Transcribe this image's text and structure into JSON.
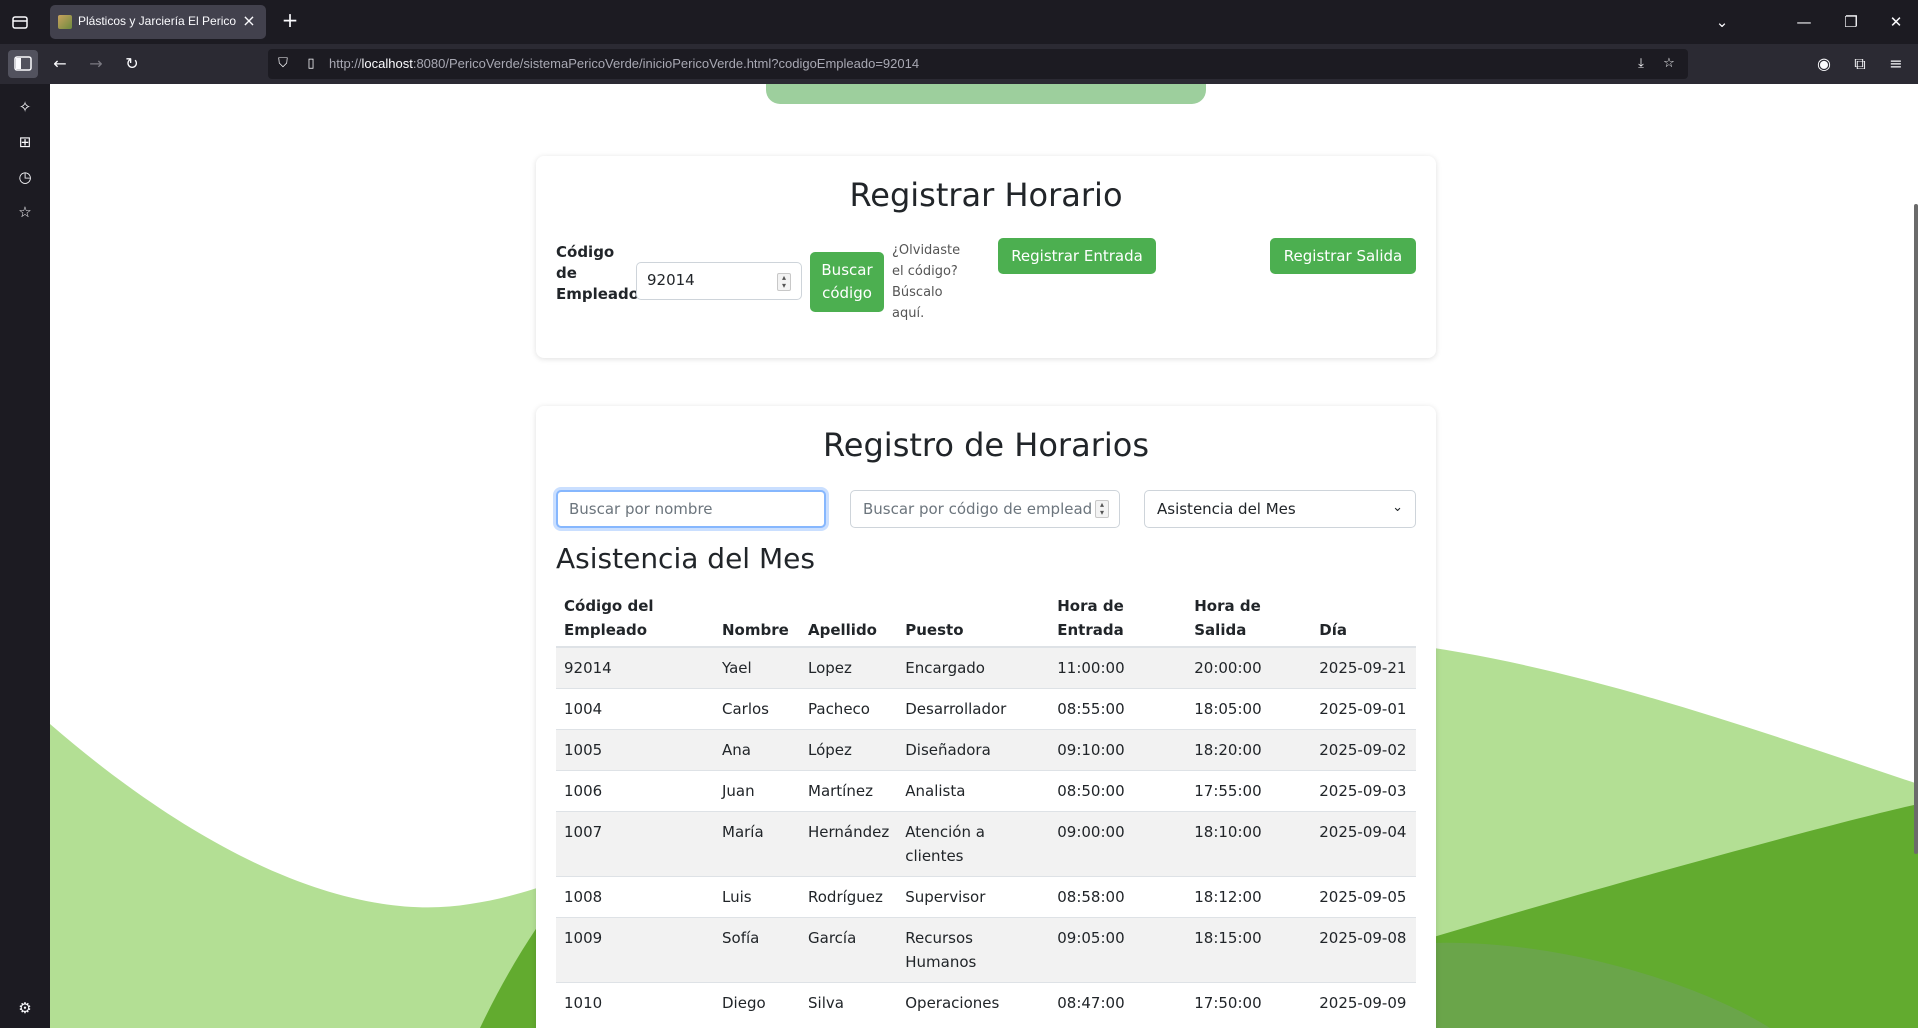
{
  "browser": {
    "tab_title": "Plásticos y Jarciería El Perico Verde",
    "url_host": "localhost",
    "url_prefix": "http://",
    "url_rest": ":8080/PericoVerde/sistemaPericoVerde/inicioPericoVerde.html?codigoEmpleado=92014"
  },
  "registrar": {
    "title": "Registrar Horario",
    "code_label": "Código de Empleado",
    "code_value": "92014",
    "search_button": "Buscar código",
    "forgot_text": "¿Olvidaste el código? Búscalo aquí.",
    "entrada_button": "Registrar Entrada",
    "salida_button": "Registrar Salida"
  },
  "registro": {
    "title": "Registro de Horarios",
    "search_name_placeholder": "Buscar por nombre",
    "search_code_placeholder": "Buscar por código de empleado",
    "filter_selected": "Asistencia del Mes",
    "section_title": "Asistencia del Mes",
    "columns": [
      "Código del Empleado",
      "Nombre",
      "Apellido",
      "Puesto",
      "Hora de Entrada",
      "Hora de Salida",
      "Día"
    ],
    "rows": [
      [
        "92014",
        "Yael",
        "Lopez",
        "Encargado",
        "11:00:00",
        "20:00:00",
        "2025-09-21"
      ],
      [
        "1004",
        "Carlos",
        "Pacheco",
        "Desarrollador",
        "08:55:00",
        "18:05:00",
        "2025-09-01"
      ],
      [
        "1005",
        "Ana",
        "López",
        "Diseñadora",
        "09:10:00",
        "18:20:00",
        "2025-09-02"
      ],
      [
        "1006",
        "Juan",
        "Martínez",
        "Analista",
        "08:50:00",
        "17:55:00",
        "2025-09-03"
      ],
      [
        "1007",
        "María",
        "Hernández",
        "Atención a clientes",
        "09:00:00",
        "18:10:00",
        "2025-09-04"
      ],
      [
        "1008",
        "Luis",
        "Rodríguez",
        "Supervisor",
        "08:58:00",
        "18:12:00",
        "2025-09-05"
      ],
      [
        "1009",
        "Sofía",
        "García",
        "Recursos Humanos",
        "09:05:00",
        "18:15:00",
        "2025-09-08"
      ],
      [
        "1010",
        "Diego",
        "Silva",
        "Operaciones",
        "08:47:00",
        "17:50:00",
        "2025-09-09"
      ]
    ]
  },
  "colors": {
    "accent_green": "#4caf50",
    "wave_light": "#b3df94",
    "wave_mid": "#62ab2f"
  }
}
